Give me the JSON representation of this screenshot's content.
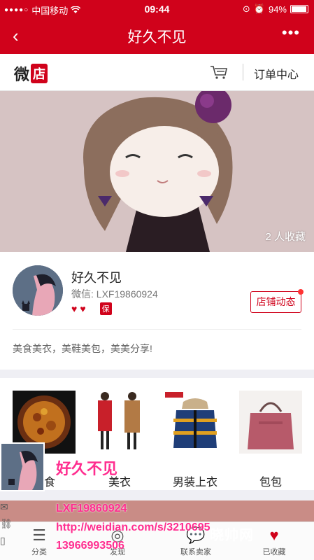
{
  "status": {
    "carrier": "中国移动",
    "time": "09:44",
    "battery": "94%"
  },
  "nav": {
    "title": "好久不见"
  },
  "header": {
    "logo_a": "微",
    "logo_b": "店",
    "orders": "订单中心"
  },
  "banner": {
    "favorites": "2 人收藏"
  },
  "profile": {
    "name": "好久不见",
    "wechat": "微信: LXF19860924",
    "guarantee": "保",
    "dynamic_btn": "店铺动态",
    "desc": "美食美衣，美鞋美包，美美分享!"
  },
  "categories": [
    {
      "label": "美食"
    },
    {
      "label": "美衣"
    },
    {
      "label": "男装上衣"
    },
    {
      "label": "包包"
    }
  ],
  "overlay": {
    "name": "好久不见",
    "line1": "LXF19860924",
    "line2": "http://weidian.com/s/3210695",
    "line3": "13966993506"
  },
  "tabs": [
    {
      "label": "分类",
      "icon": "category-icon"
    },
    {
      "label": "发现",
      "icon": "discover-icon"
    },
    {
      "label": "联系卖家",
      "icon": "chat-icon"
    },
    {
      "label": "已收藏",
      "icon": "heart-icon"
    }
  ],
  "watermark": "晓帅网"
}
